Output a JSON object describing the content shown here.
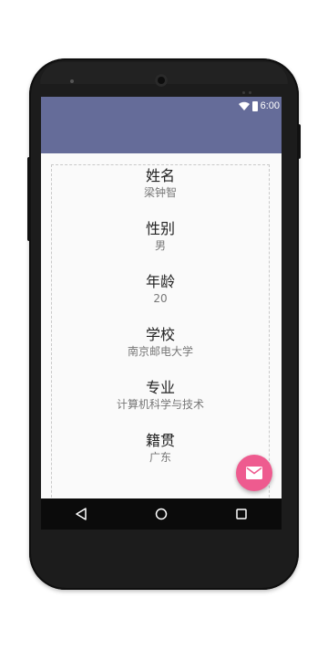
{
  "status_bar": {
    "time": "6:00",
    "icons": [
      "wifi-icon",
      "battery-icon"
    ]
  },
  "app_bar": {
    "color": "#656c99"
  },
  "profile": {
    "fields": [
      {
        "label": "姓名",
        "value": "梁钟智"
      },
      {
        "label": "性别",
        "value": "男"
      },
      {
        "label": "年龄",
        "value": "20"
      },
      {
        "label": "学校",
        "value": "南京邮电大学"
      },
      {
        "label": "专业",
        "value": "计算机科学与技术"
      },
      {
        "label": "籍贯",
        "value": "广东"
      }
    ]
  },
  "fab": {
    "icon": "mail-icon",
    "color": "#ee5b8f"
  },
  "nav_bar": {
    "buttons": [
      "back-icon",
      "home-icon",
      "recents-icon"
    ]
  }
}
